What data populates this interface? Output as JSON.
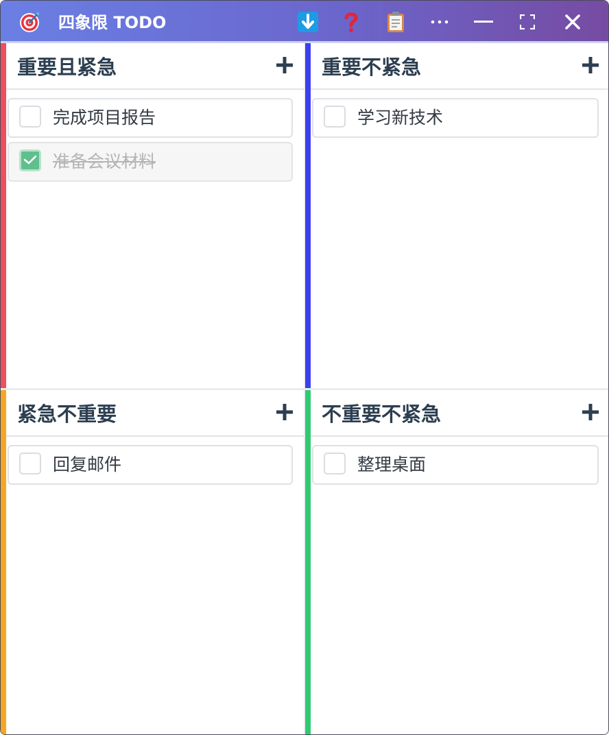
{
  "window": {
    "title": "四象限 TODO",
    "icons": {
      "app": "target-icon",
      "download": "download-icon",
      "help": "question-icon",
      "clipboard": "clipboard-icon",
      "more": "more-icon",
      "minimize": "minimize-icon",
      "fullscreen": "fullscreen-icon",
      "close": "close-icon"
    }
  },
  "colors": {
    "titlebar_start": "#6a7fe4",
    "titlebar_end": "#764ba2",
    "urgent_important": "#f04e5e",
    "important_not_urgent": "#3b3ff0",
    "urgent_not_important": "#f5a623",
    "not_urgent_not_important": "#2ecc71",
    "checked": "#5fbf8f"
  },
  "quadrants": [
    {
      "title": "重要且紧急",
      "add_icon": "plus-icon",
      "tasks": [
        {
          "text": "完成项目报告",
          "done": false
        },
        {
          "text": "准备会议材料",
          "done": true
        }
      ]
    },
    {
      "title": "重要不紧急",
      "add_icon": "plus-icon",
      "tasks": [
        {
          "text": "学习新技术",
          "done": false
        }
      ]
    },
    {
      "title": "紧急不重要",
      "add_icon": "plus-icon",
      "tasks": [
        {
          "text": "回复邮件",
          "done": false
        }
      ]
    },
    {
      "title": "不重要不紧急",
      "add_icon": "plus-icon",
      "tasks": [
        {
          "text": "整理桌面",
          "done": false
        }
      ]
    }
  ]
}
